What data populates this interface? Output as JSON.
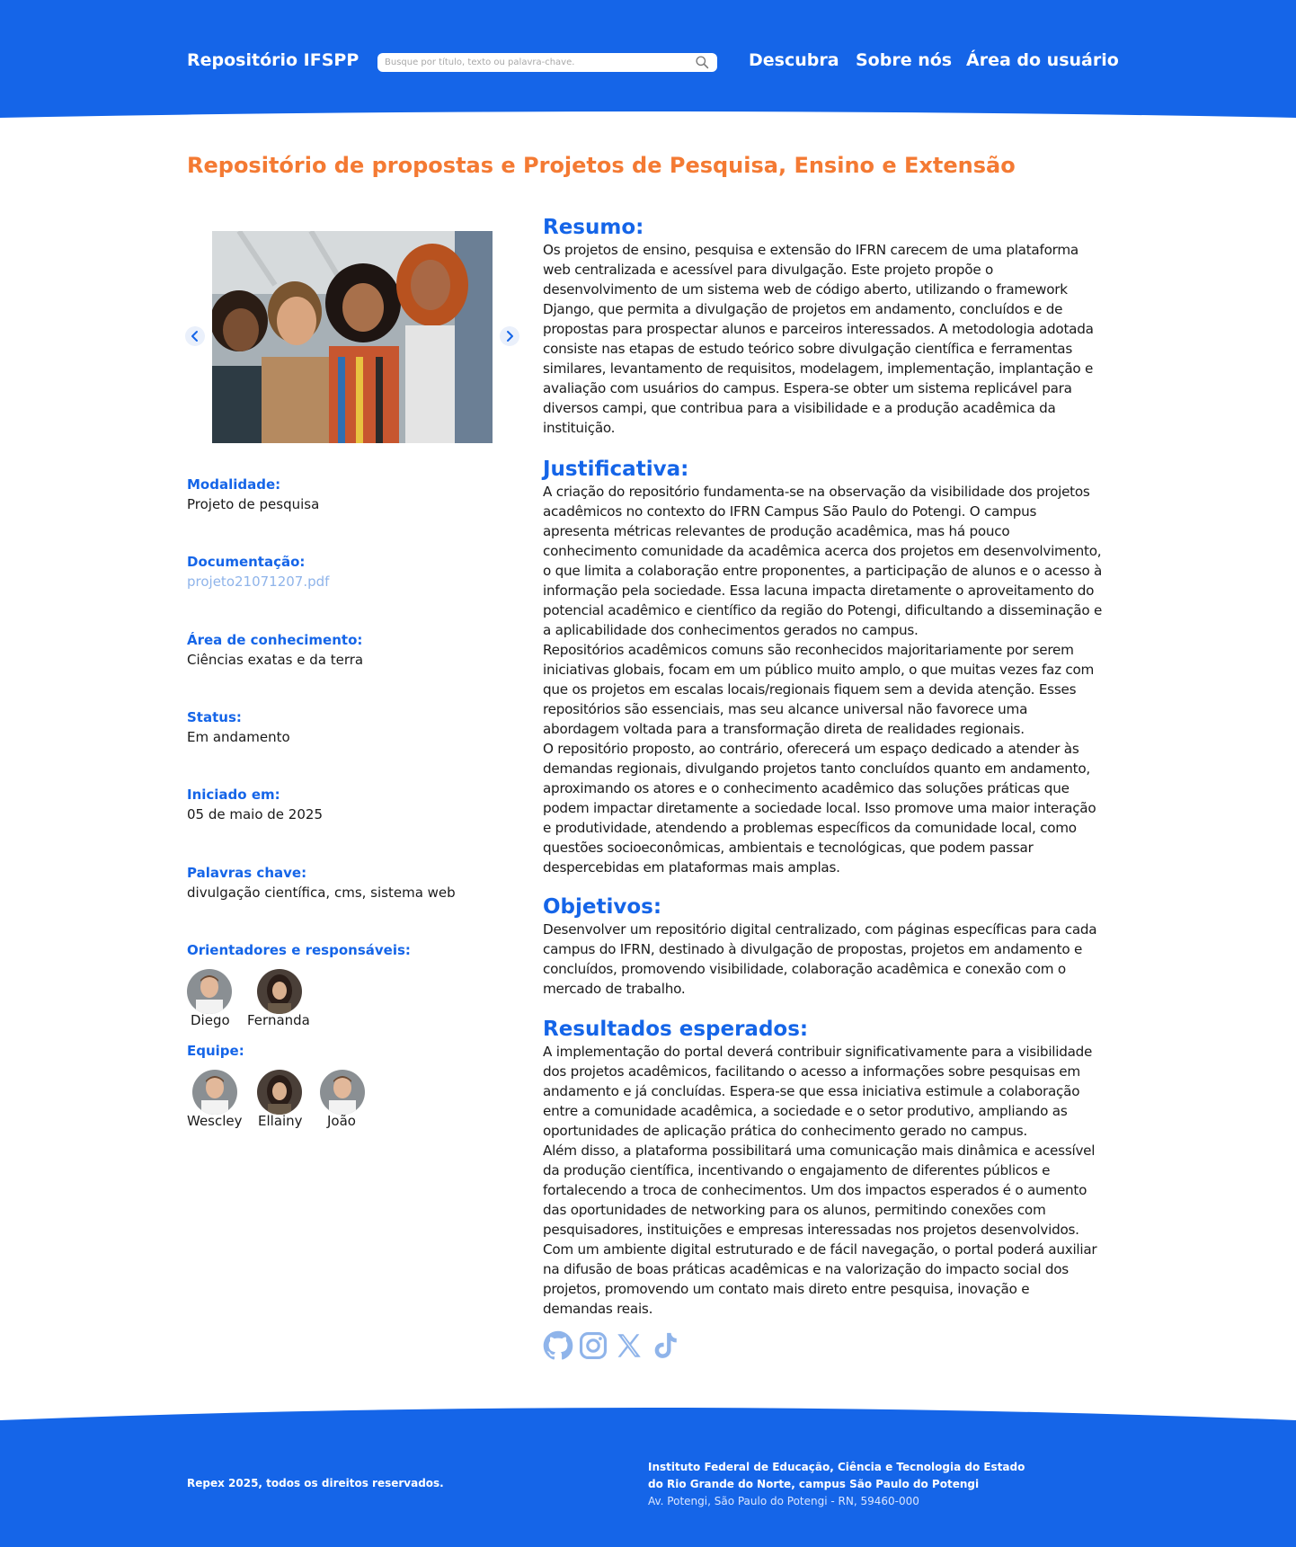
{
  "colors": {
    "primary": "#1565e8",
    "accent_title": "#f47a33",
    "link": "#8fb4ea",
    "social": "#8fb4ea"
  },
  "header": {
    "brand": "Repositório IFSPP",
    "search_placeholder": "Busque por título, texto ou palavra-chave.",
    "search_icon": "search-icon",
    "nav": [
      "Descubra",
      "Sobre nós",
      "Área do usuário"
    ]
  },
  "page_title": "Repositório de propostas e Projetos de Pesquisa, Ensino e Extensão",
  "carousel": {
    "prev_icon": "chevron-left-icon",
    "next_icon": "chevron-right-icon"
  },
  "meta": [
    {
      "label": "Modalidade:",
      "value": "Projeto de pesquisa"
    },
    {
      "label": "Documentação:",
      "value": "projeto21071207.pdf"
    },
    {
      "label": "Área de conhecimento:",
      "value": "Ciências exatas e da terra"
    },
    {
      "label": "Status:",
      "value": "Em andamento"
    },
    {
      "label": "Iniciado em:",
      "value": "05 de maio de 2025"
    },
    {
      "label": "Palavras chave:",
      "value": "divulgação científica, cms, sistema web"
    }
  ],
  "advisors": {
    "label": "Orientadores e responsáveis:",
    "people": [
      "Diego",
      "Fernanda"
    ]
  },
  "team": {
    "label": "Equipe:",
    "people": [
      "Wescley",
      "Ellainy",
      "João"
    ]
  },
  "sections": {
    "resumo": {
      "title": "Resumo:",
      "lines": [
        "Os projetos de ensino, pesquisa e extensão do IFRN carecem de uma plataforma",
        "web centralizada e acessível para divulgação. Este projeto propõe o",
        "desenvolvimento de um sistema web de código aberto, utilizando o framework",
        "Django, que permita a divulgação de projetos em andamento, concluídos e de",
        "propostas para prospectar alunos e parceiros interessados. A metodologia adotada",
        "consiste nas etapas de estudo teórico sobre divulgação científica e ferramentas",
        "similares, levantamento de requisitos, modelagem, implementação, implantação e",
        "avaliação com usuários do campus. Espera-se obter um sistema replicável para",
        "diversos campi, que contribua para a visibilidade e a produção acadêmica da",
        "instituição."
      ]
    },
    "justificativa": {
      "title": "Justificativa:",
      "lines": [
        "A criação do repositório fundamenta-se na observação da visibilidade dos projetos",
        "acadêmicos no contexto do IFRN Campus São Paulo do Potengi. O campus",
        "apresenta métricas relevantes de produção acadêmica, mas há pouco",
        "conhecimento comunidade da acadêmica acerca dos projetos em desenvolvimento,",
        "o que limita a colaboração entre proponentes, a participação de alunos e o acesso à",
        "informação pela sociedade. Essa lacuna impacta diretamente o aproveitamento do",
        "potencial acadêmico e científico da região do Potengi, dificultando a disseminação e",
        "a aplicabilidade dos conhecimentos gerados no campus.",
        "Repositórios acadêmicos comuns são reconhecidos majoritariamente por serem",
        "iniciativas globais, focam em um público muito amplo, o que muitas vezes faz com",
        "que os projetos em escalas locais/regionais fiquem sem a devida atenção. Esses",
        "repositórios são essenciais, mas seu alcance universal não favorece uma",
        "abordagem voltada para a transformação direta de realidades regionais.",
        "O repositório proposto, ao contrário, oferecerá um espaço dedicado a atender às",
        "demandas regionais, divulgando projetos tanto concluídos quanto em andamento,",
        "aproximando os atores e o conhecimento acadêmico das soluções práticas que",
        "podem impactar diretamente a sociedade local. Isso promove uma maior interação",
        "e produtividade, atendendo a problemas específicos da comunidade local, como",
        "questões socioeconômicas, ambientais e tecnológicas, que podem passar",
        "despercebidas em plataformas mais amplas."
      ]
    },
    "objetivos": {
      "title": "Objetivos:",
      "lines": [
        "Desenvolver um repositório digital centralizado, com páginas específicas para cada",
        "campus do IFRN, destinado à divulgação de propostas, projetos em andamento e",
        "concluídos, promovendo visibilidade, colaboração acadêmica e conexão com o",
        "mercado de trabalho."
      ]
    },
    "resultados": {
      "title": "Resultados esperados:",
      "lines": [
        "A implementação do portal deverá contribuir significativamente para a visibilidade",
        "dos projetos acadêmicos, facilitando o acesso a informações sobre pesquisas em",
        "andamento e já concluídas. Espera-se que essa iniciativa estimule a colaboração",
        "entre a comunidade acadêmica, a sociedade e o setor produtivo, ampliando as",
        "oportunidades de aplicação prática do conhecimento gerado no campus.",
        "Além disso, a plataforma possibilitará uma comunicação mais dinâmica e acessível",
        "da produção científica, incentivando o engajamento de diferentes públicos e",
        "fortalecendo a troca de conhecimentos. Um dos impactos esperados é o aumento",
        "das oportunidades de networking para os alunos, permitindo conexões com",
        "pesquisadores, instituições e empresas interessadas nos projetos desenvolvidos.",
        "Com um ambiente digital estruturado e de fácil navegação, o portal poderá auxiliar",
        "na difusão de boas práticas acadêmicas e na valorização do impacto social dos",
        "projetos, promovendo um contato mais direto entre pesquisa, inovação e",
        "demandas reais."
      ]
    }
  },
  "social": [
    "github-icon",
    "instagram-icon",
    "x-icon",
    "tiktok-icon"
  ],
  "footer": {
    "copyright": "Repex 2025, todos os direitos reservados.",
    "institution_line1": "Instituto Federal de Educação, Ciência e Tecnologia do Estado",
    "institution_line2": "do Rio Grande do Norte, campus São Paulo do Potengi",
    "address": "Av. Potengi, São Paulo do Potengi - RN, 59460-000"
  }
}
